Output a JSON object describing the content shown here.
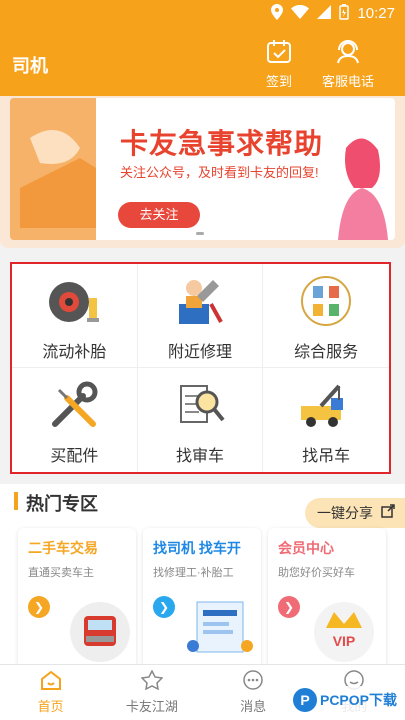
{
  "statusbar": {
    "time": "10:27"
  },
  "appbar": {
    "title": "司机",
    "checkin_label": "签到",
    "service_label": "客服电话"
  },
  "banner": {
    "title": "卡友急事求帮助",
    "subtitle": "关注公众号，及时看到卡友的回复!",
    "button": "去关注"
  },
  "services": [
    {
      "label": "流动补胎",
      "icon": "tire-icon"
    },
    {
      "label": "附近修理",
      "icon": "repair-toolbox-icon"
    },
    {
      "label": "综合服务",
      "icon": "services-icon"
    },
    {
      "label": "买配件",
      "icon": "wrench-screwdriver-icon"
    },
    {
      "label": "找审车",
      "icon": "document-search-icon"
    },
    {
      "label": "找吊车",
      "icon": "tow-truck-icon"
    }
  ],
  "hot": {
    "title": "热门专区",
    "share_label": "一键分享",
    "cards": [
      {
        "title": "二手车交易",
        "subtitle": "直通买卖车主",
        "color": "#f5a623",
        "arrow_color": "#f5a623"
      },
      {
        "title": "找司机 找车开",
        "subtitle": "找修理工·补胎工",
        "color": "#1e88e5",
        "arrow_color": "#29a8f0"
      },
      {
        "title": "会员中心",
        "subtitle": "助您好价买好车",
        "color": "#ef6b75",
        "arrow_color": "#ef6b75"
      }
    ]
  },
  "nav": [
    {
      "label": "首页",
      "icon": "home-icon"
    },
    {
      "label": "卡友江湖",
      "icon": "star-icon"
    },
    {
      "label": "消息",
      "icon": "message-icon"
    },
    {
      "label": "我的",
      "icon": "profile-icon"
    }
  ],
  "watermark": {
    "text": "PCPOP下载"
  },
  "colors": {
    "brand": "#f7a21b",
    "highlight_border": "#e0262b"
  }
}
